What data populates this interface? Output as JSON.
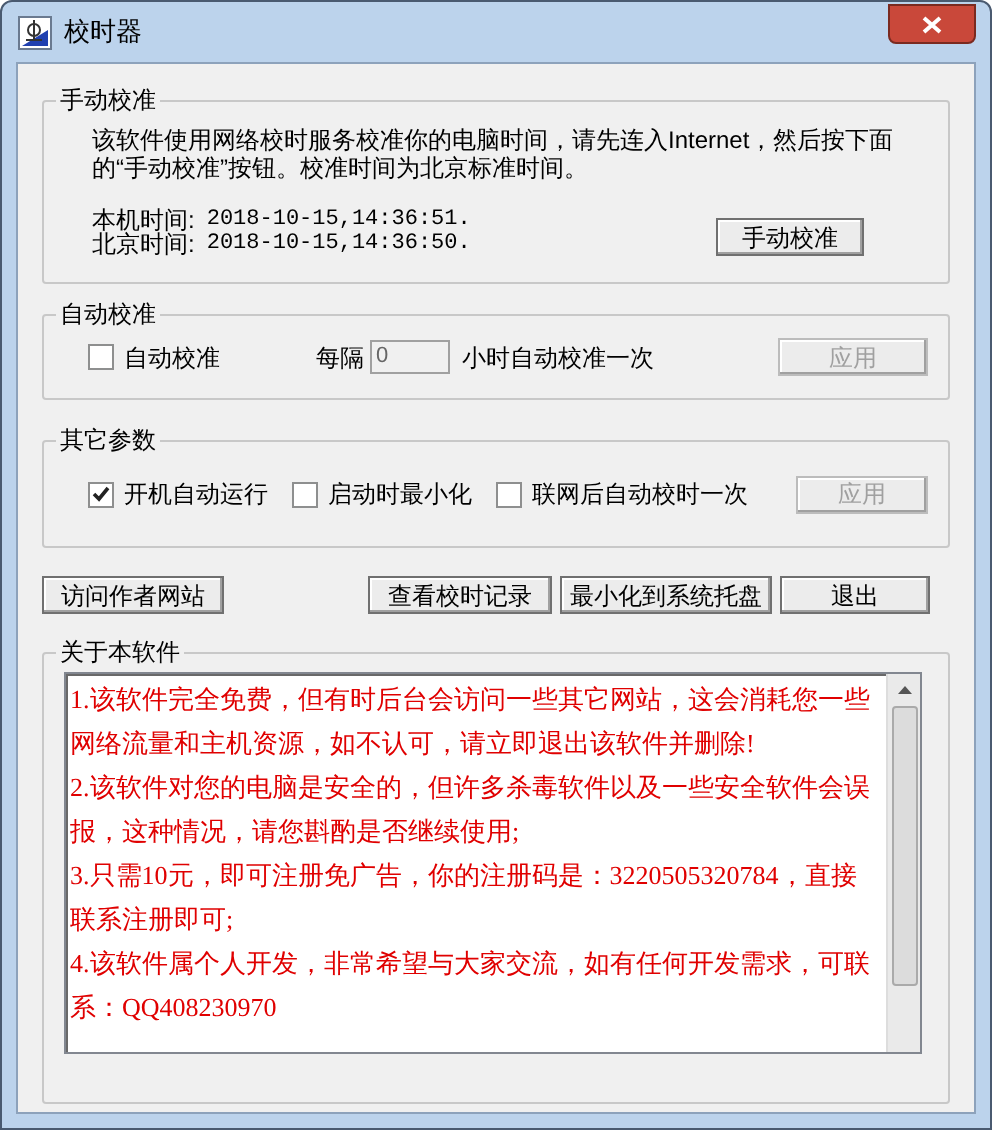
{
  "window": {
    "title": "校时器"
  },
  "manual": {
    "title": "手动校准",
    "description": "该软件使用网络校时服务校准你的电脑时间，请先连入Internet，然后按下面的“手动校准”按钮。校准时间为北京标准时间。",
    "times": [
      {
        "label": "本机时间:",
        "value": "2018-10-15,14:36:51."
      },
      {
        "label": "北京时间:",
        "value": "2018-10-15,14:36:50."
      }
    ],
    "button": "手动校准"
  },
  "auto": {
    "title": "自动校准",
    "checkbox": {
      "label": "自动校准",
      "checked": false
    },
    "interval_label": "每隔",
    "interval_value": "0",
    "interval_suffix": "小时自动校准一次",
    "apply": {
      "label": "应用",
      "disabled": true
    }
  },
  "other": {
    "title": "其它参数",
    "checkboxes": [
      {
        "label": "开机自动运行",
        "checked": true
      },
      {
        "label": "启动时最小化",
        "checked": false
      },
      {
        "label": "联网后自动校时一次",
        "checked": false
      }
    ],
    "apply": {
      "label": "应用",
      "disabled": true
    }
  },
  "buttons": [
    "访问作者网站",
    "查看校时记录",
    "最小化到系统托盘",
    "退出"
  ],
  "about": {
    "title": "关于本软件",
    "paragraphs": [
      "1.该软件完全免费，但有时后台会访问一些其它网站，这会消耗您一些网络流量和主机资源，如不认可，请立即退出该软件并删除!",
      "2.该软件对您的电脑是安全的，但许多杀毒软件以及一些安全软件会误报，这种情况，请您斟酌是否继续使用;",
      "3.只需10元，即可注册免广告，你的注册码是：3220505320784，直接联系注册即可;",
      "4.该软件属个人开发，非常希望与大家交流，如有任何开发需求，可联系：QQ408230970"
    ]
  }
}
